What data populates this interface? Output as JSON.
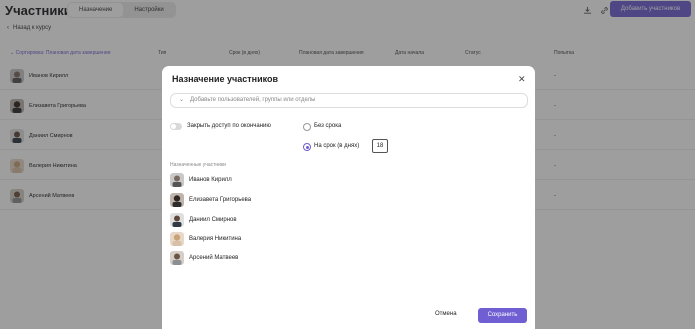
{
  "header": {
    "title": "Участники",
    "tabs": [
      {
        "label": "Назначение"
      },
      {
        "label": "Настройки"
      }
    ],
    "add_button": "Добавить участников"
  },
  "back_link": "Назад к курсу",
  "table": {
    "columns": [
      "Сортировка: Плановая дата завершения",
      "Тип",
      "Срок (в днях)",
      "Плановая дата завершения",
      "Дата начала",
      "Статус",
      "Попытка"
    ],
    "rows": [
      {
        "name": "Иванов Кирилл",
        "attempt": "-"
      },
      {
        "name": "Елизавета Григорьева",
        "attempt": "-"
      },
      {
        "name": "Даниил Смирнов",
        "attempt": "-"
      },
      {
        "name": "Валерия Никитина",
        "attempt": "-"
      },
      {
        "name": "Арсений Матвеев",
        "attempt": "-"
      }
    ]
  },
  "modal": {
    "title": "Назначение участников",
    "select_placeholder": "Добавьте пользователей, группы или отделы",
    "toggle_label": "Закрыть доступ по окончанию",
    "radio_no_limit": "Без срока",
    "radio_days": "На срок (в днях)",
    "days_value": "18",
    "section_label": "Назначенные участники",
    "participants": [
      "Иванов Кирилл",
      "Елизавета Григорьева",
      "Даниил Смирнов",
      "Валерия Никитина",
      "Арсений Матвеев"
    ],
    "cancel": "Отмена",
    "save": "Сохранить"
  },
  "colors": {
    "accent": "#6f5fd3",
    "overlay": "rgba(40,40,40,0.45)"
  }
}
